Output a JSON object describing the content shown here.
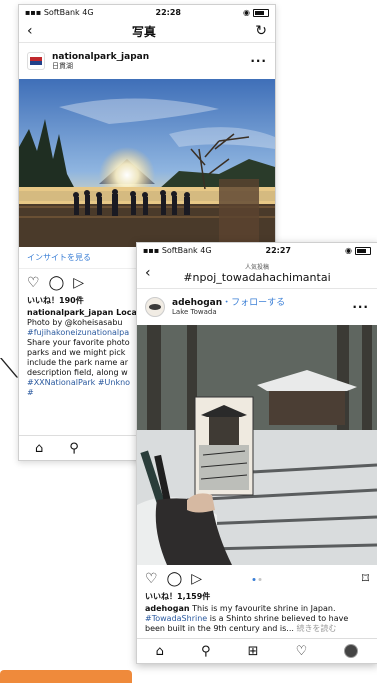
{
  "screen1": {
    "status": {
      "carrier": "SoftBank 4G",
      "time": "22:28"
    },
    "nav": {
      "title": "写真"
    },
    "post": {
      "username": "nationalpark_japan",
      "location": "日貫湖",
      "insight_link": "インサイトを見る",
      "likes": "いいね！190件",
      "caption_lines": [
        "nationalpark_japan Loca",
        "Photo by @koheisasabu",
        "#fujihakoneizunationalpa",
        "Share your favorite photo",
        "parks and we might pick",
        "include the park name ar",
        "description field, along w",
        "#XXNationalPark #Unkno",
        "#"
      ]
    }
  },
  "screen2": {
    "status": {
      "carrier": "SoftBank 4G",
      "time": "22:27"
    },
    "nav": {
      "subtitle": "人気投稿",
      "title": "#npoj_towadahachimantai"
    },
    "post": {
      "username": "adehogan",
      "follow": "・フォローする",
      "location": "Lake Towada",
      "likes": "いいね！1,159件",
      "caption_user": "adehogan",
      "caption_text": " This is my favourite shrine in Japan. ",
      "caption_tag": "#TowadaShrine",
      "caption_rest": " is a Shinto shrine believed to have been built in the 9th century and is... ",
      "caption_more": "続きを読む"
    }
  },
  "colors": {
    "link": "#3b7fd6",
    "hashtag": "#2b5a9f",
    "accent_tab": "#ef8a3b"
  },
  "icons": [
    "back-chevron-icon",
    "refresh-icon",
    "heart-icon",
    "comment-icon",
    "share-icon",
    "bookmark-icon",
    "home-icon",
    "search-icon",
    "add-icon",
    "activity-icon",
    "profile-icon",
    "more-icon"
  ]
}
